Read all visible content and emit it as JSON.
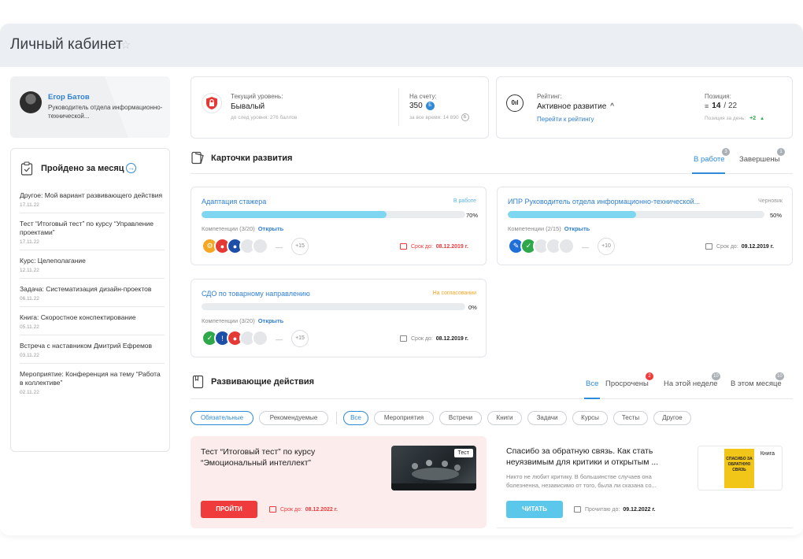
{
  "header": {
    "title": "Личный кабинет"
  },
  "profile": {
    "name": "Егор Батов",
    "position": "Руководитель отдела информационно-технической..."
  },
  "done": {
    "title": "Пройдено за месяц",
    "items": [
      {
        "text": "Другое: Мой вариант развивающего действия",
        "date": "17.11.22"
      },
      {
        "text": "Тест “Итоговый тест” по курсу “Управление проектами”",
        "date": "17.11.22"
      },
      {
        "text": "Курс: Целеполагание",
        "date": "12.11.22"
      },
      {
        "text": "Задача: Систематизация дизайн-проектов",
        "date": "06.11.22"
      },
      {
        "text": "Книга: Скоростное конспектирование",
        "date": "05.11.22"
      },
      {
        "text": "Встреча с наставником Дмитрий Ефремов",
        "date": "03.11.22"
      },
      {
        "text": "Мероприятие: Конференция на тему “Работа в коллективе”",
        "date": "02.11.22"
      }
    ]
  },
  "level": {
    "label": "Текущий уровень:",
    "value": "Бывалый",
    "next": "до след уровня: 276 баллов",
    "account_label": "На счету:",
    "account_value": "350",
    "account_badge": "Б",
    "total": "за все время: 14 890",
    "total_badge": "Б"
  },
  "rating": {
    "label": "Рейтинг:",
    "value": "Активное развитие",
    "chevron": "^",
    "link": "Перейти к рейтингу",
    "pos_label": "Позиция:",
    "pos_value": "14",
    "pos_total": "/ 22",
    "day_label": "Позиция за день:",
    "day_value": "+2",
    "icon_text": "0ıl"
  },
  "cards_section": {
    "title": "Карточки развития",
    "tab_work": "В работе",
    "tab_work_count": "3",
    "tab_done": "Завершены",
    "tab_done_count": "1"
  },
  "cards": [
    {
      "title": "Адаптация стажера",
      "status": "В работе",
      "status_color": "#5ab4e8",
      "progress": 0.7,
      "pct": "70%",
      "comp_label": "Компетенции (3/20)",
      "open": "Открыть",
      "more": "+15",
      "deadline_label": "Срок до:",
      "deadline": "08.12.2019 г."
    },
    {
      "title": "ИПР Руководитель отдела информационно-технической...",
      "status": "Черновик",
      "status_color": "#999999",
      "progress": 0.5,
      "pct": "50%",
      "comp_label": "Компетенции (2/15)",
      "open": "Открыть",
      "more": "+10",
      "deadline_label": "Срок до:",
      "deadline": "09.12.2019 г."
    },
    {
      "title": "СДО по товарному направлению",
      "status": "На согласовании",
      "status_color": "#f5a623",
      "progress": 0,
      "pct": "0%",
      "comp_label": "Компетенции (3/20)",
      "open": "Открыть",
      "more": "+15",
      "deadline_label": "Срок до:",
      "deadline": "08.12.2019 г."
    }
  ],
  "actions_section": {
    "title": "Развивающие действия",
    "tab_all": "Все",
    "tab_overdue": "Просрочены",
    "tab_overdue_count": "2",
    "tab_week": "На этой неделе",
    "tab_week_count": "10",
    "tab_month": "В этом месяце",
    "tab_month_count": "10"
  },
  "filters": {
    "type": [
      "Обязательные",
      "Рекомендуемые"
    ],
    "categories": [
      "Все",
      "Мероприятия",
      "Встречи",
      "Книги",
      "Задачи",
      "Курсы",
      "Тесты",
      "Другое"
    ]
  },
  "actions": [
    {
      "title": "Тест “Итоговый тест” по курсу “Эмоциональный интеллект”",
      "tag": "Тест",
      "button": "ПРОЙТИ",
      "deadline_label": "Срок до:",
      "deadline": "08.12.2022 г."
    },
    {
      "title": "Спасибо за обратную связь. Как стать неуязвимым для критики и открытым ...",
      "desc": "Никто не любит критику. В большинстве случаев она болезненна, независимо от того, была ли сказана со...",
      "tag": "Книга",
      "button": "ЧИТАТЬ",
      "deadline_label": "Прочитаю до:",
      "deadline": "09.12.2022 г.",
      "book_text": "СПАСИБО ЗА ОБРАТНУЮ СВЯЗЬ"
    }
  ],
  "colors": {
    "accent": "#2f8bd8",
    "danger": "#ef3b3b",
    "progress": "#7fd6f0",
    "read_button": "#5bc7ea"
  }
}
